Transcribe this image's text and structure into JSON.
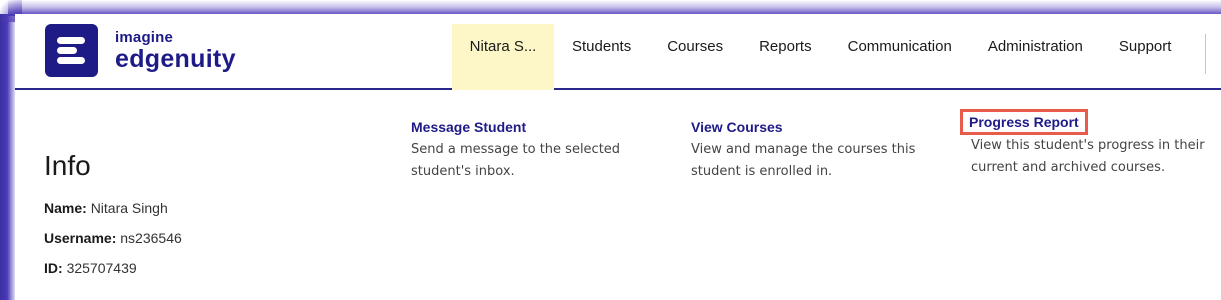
{
  "brand": {
    "line1": "imagine",
    "line2": "edgenuity"
  },
  "nav": {
    "items": [
      {
        "label": "Nitara S..."
      },
      {
        "label": "Students"
      },
      {
        "label": "Courses"
      },
      {
        "label": "Reports"
      },
      {
        "label": "Communication"
      },
      {
        "label": "Administration"
      },
      {
        "label": "Support"
      }
    ]
  },
  "info": {
    "title": "Info",
    "name_label": "Name:",
    "name_value": "Nitara Singh",
    "username_label": "Username:",
    "username_value": "ns236546",
    "id_label": "ID:",
    "id_value": "325707439"
  },
  "actions": [
    {
      "label": "Message Student",
      "desc1": "Send a message to the selected",
      "desc2": "student's inbox."
    },
    {
      "label": "View Courses",
      "desc1": "View and manage the courses this",
      "desc2": "student is enrolled in."
    },
    {
      "label": "Progress Report",
      "desc1": "View this student's progress in their",
      "desc2": "current and archived courses."
    }
  ],
  "colors": {
    "brand": "#1e1b87",
    "active_nav": "#fdf7c8",
    "highlight": "#e85a4a"
  }
}
